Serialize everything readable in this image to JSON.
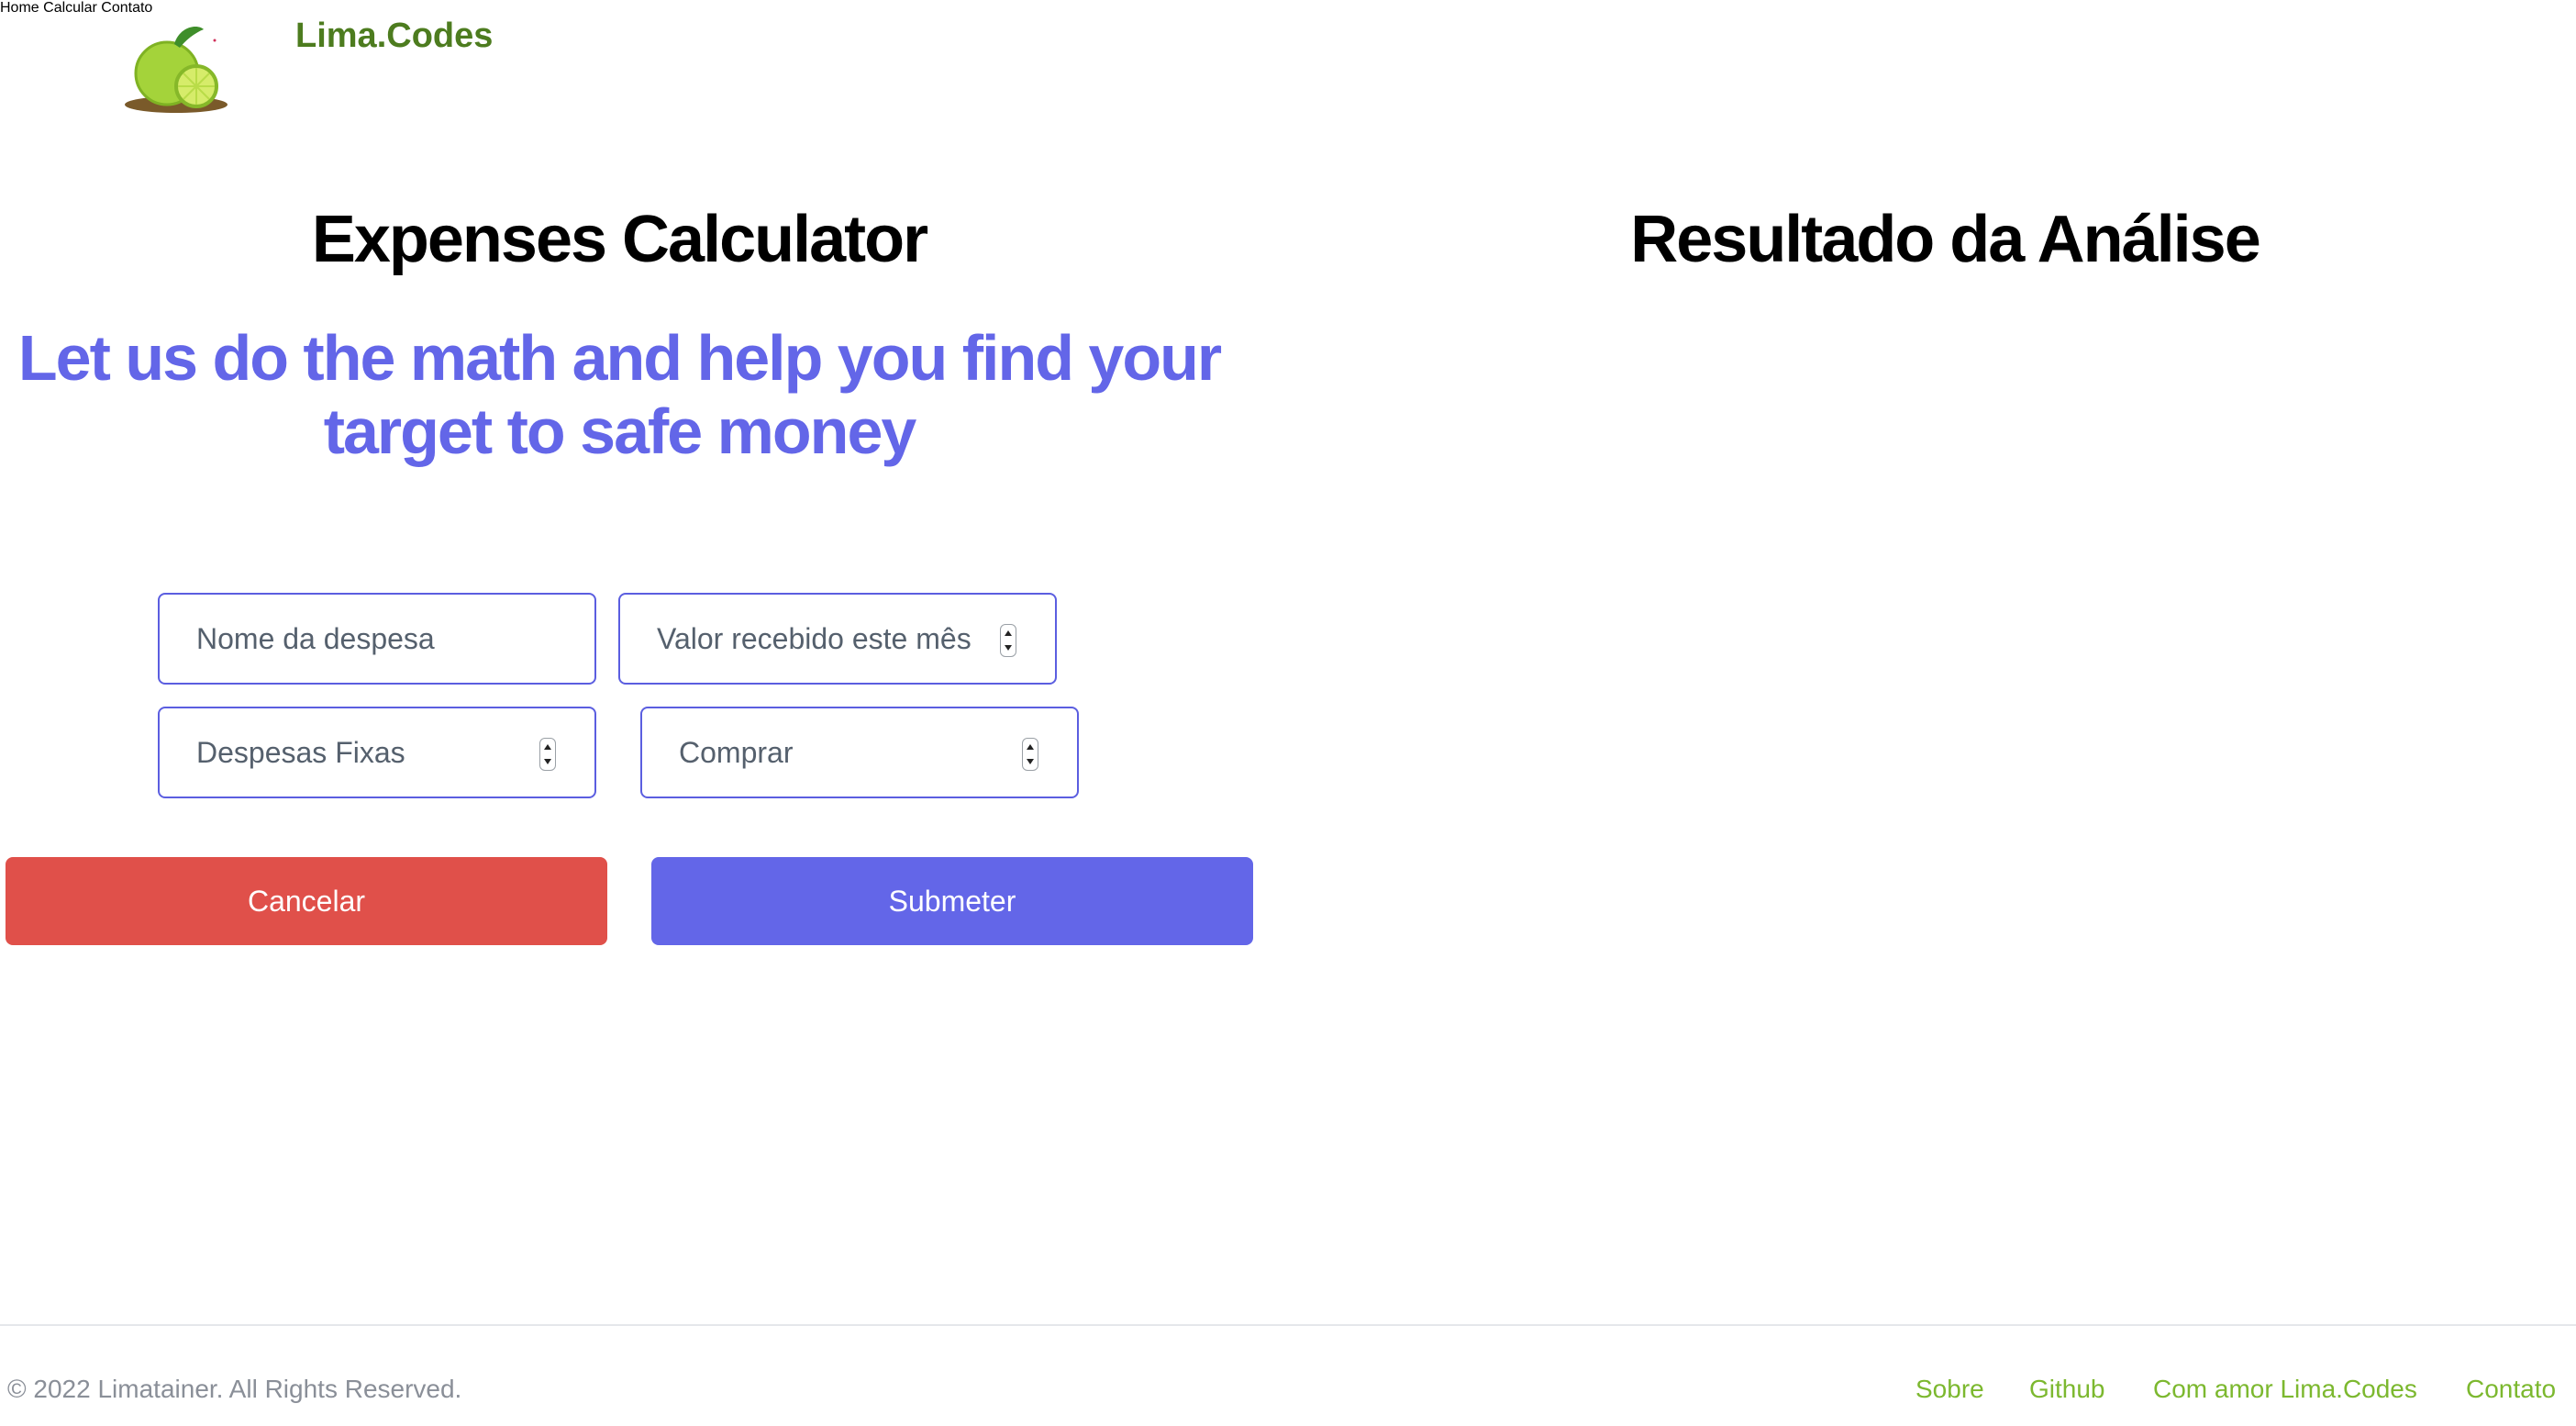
{
  "header": {
    "brand": "Lima.Codes",
    "logo_icon": "lime-fruit-icon",
    "nav": [
      "Home",
      "Calcular",
      "Contato"
    ]
  },
  "left": {
    "title": "Expenses Calculator",
    "tagline_line1": "Let us do the math and help you find your",
    "tagline_line2": "target to safe money"
  },
  "right": {
    "title": "Resultado da Análise"
  },
  "form": {
    "expense_name_placeholder": "Nome da despesa",
    "income_placeholder": "Valor recebido este mês",
    "fixed_expenses_placeholder": "Despesas Fixas",
    "purchase_placeholder": "Comprar"
  },
  "buttons": {
    "cancel": "Cancelar",
    "submit": "Submeter"
  },
  "footer": {
    "copyright": "© 2022 Limatainer. All Rights Reserved.",
    "links": [
      "Sobre",
      "Github",
      "Com amor Lima.Codes",
      "Contato"
    ]
  },
  "colors": {
    "brand_green": "#4d7c1f",
    "link_green": "#7cb82f",
    "accent_indigo": "#6366e8",
    "cancel_red": "#e0504a"
  }
}
